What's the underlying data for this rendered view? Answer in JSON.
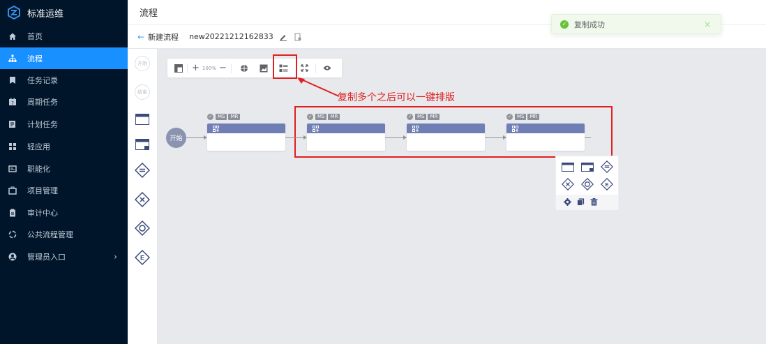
{
  "brand": {
    "title": "标准运维"
  },
  "nav": [
    {
      "label": "首页",
      "icon": "home-icon"
    },
    {
      "label": "流程",
      "icon": "flow-icon",
      "active": true
    },
    {
      "label": "任务记录",
      "icon": "task-record-icon"
    },
    {
      "label": "周期任务",
      "icon": "calendar-icon"
    },
    {
      "label": "计划任务",
      "icon": "plan-icon"
    },
    {
      "label": "轻应用",
      "icon": "apps-icon"
    },
    {
      "label": "职能化",
      "icon": "function-icon"
    },
    {
      "label": "项目管理",
      "icon": "project-icon"
    },
    {
      "label": "审计中心",
      "icon": "audit-icon"
    },
    {
      "label": "公共流程管理",
      "icon": "public-flow-icon"
    },
    {
      "label": "管理员入口",
      "icon": "admin-icon",
      "has_children": true
    }
  ],
  "header": {
    "title": "流程"
  },
  "subheader": {
    "back_label": "新建流程",
    "flow_name": "new20221212162833"
  },
  "toast": {
    "message": "复制成功"
  },
  "palette": {
    "start_label": "开始",
    "end_label": "结束"
  },
  "toolbar": {
    "zoom": "100%"
  },
  "annotation": {
    "text": "复制多个之后可以一键排版"
  },
  "canvas": {
    "start_label": "开始",
    "nodes": [
      {
        "tags": [
          "MS",
          "MR"
        ]
      },
      {
        "tags": [
          "MS",
          "MR"
        ]
      },
      {
        "tags": [
          "MS",
          "MR"
        ]
      },
      {
        "tags": [
          "MS",
          "MR"
        ]
      }
    ]
  },
  "colors": {
    "sidebar_bg": "#001529",
    "active": "#1890ff",
    "node_header": "#6f7fb5",
    "annotation": "#e02020",
    "toast": "#67c23a"
  }
}
